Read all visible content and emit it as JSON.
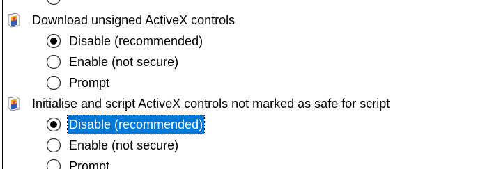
{
  "settings": [
    {
      "label": "Download unsigned ActiveX controls",
      "icon": "settings-gear-icon",
      "options": [
        {
          "label": "Disable (recommended)",
          "checked": true,
          "focused": false
        },
        {
          "label": "Enable (not secure)",
          "checked": false,
          "focused": false
        },
        {
          "label": "Prompt",
          "checked": false,
          "focused": false
        }
      ]
    },
    {
      "label": "Initialise and script ActiveX controls not marked as safe for script",
      "icon": "settings-gear-icon",
      "options": [
        {
          "label": "Disable (recommended)",
          "checked": true,
          "focused": true
        },
        {
          "label": "Enable (not secure)",
          "checked": false,
          "focused": false
        },
        {
          "label": "Prompt",
          "checked": false,
          "focused": false
        }
      ]
    }
  ],
  "colors": {
    "selection": "#0078d7",
    "radio_border": "#333333",
    "radio_dot": "#000000"
  }
}
